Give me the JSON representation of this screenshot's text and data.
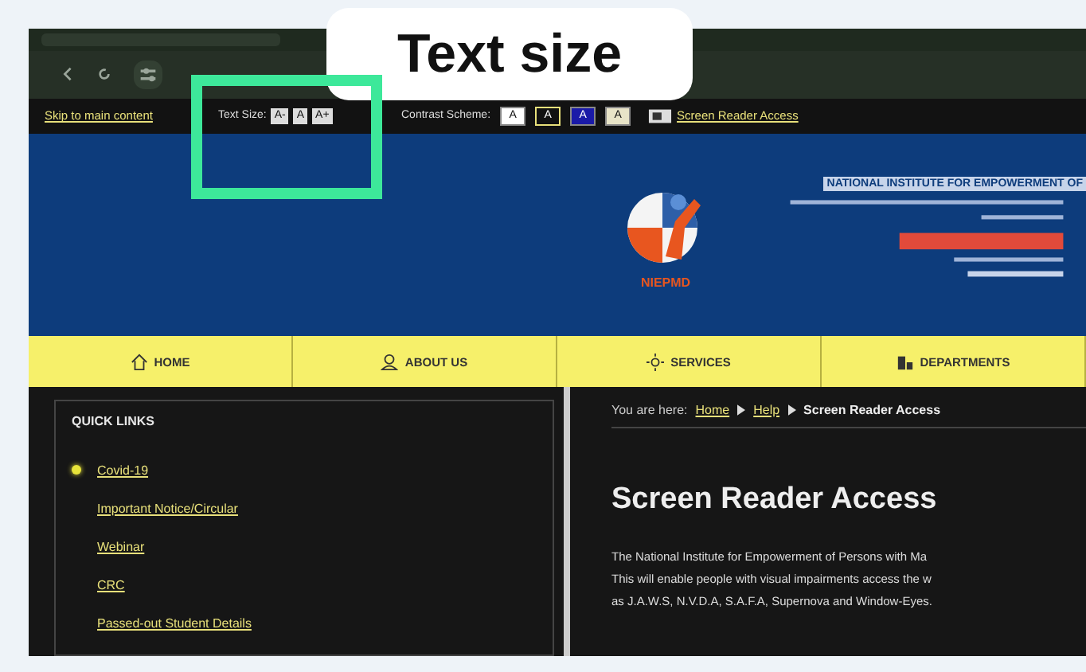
{
  "callout": {
    "label": "Text size"
  },
  "accessibility_bar": {
    "skip_link": "Skip to main content",
    "text_size_label": "Text Size:",
    "text_size_buttons": [
      "A-",
      "A",
      "A+"
    ],
    "contrast_label": "Contrast Scheme:",
    "contrast_buttons": [
      {
        "label": "A",
        "color": "#ffffff",
        "selected": false
      },
      {
        "label": "A",
        "color": "#111111",
        "selected": true
      },
      {
        "label": "A",
        "color": "#1a1aa8",
        "selected": false
      },
      {
        "label": "A",
        "color": "#e8e4c8",
        "selected": false
      }
    ],
    "screen_reader_link": "Screen Reader Access"
  },
  "header": {
    "logo_text": "NIEPMD",
    "title": "NATIONAL INSTITUTE FOR EMPOWERMENT OF"
  },
  "nav": [
    {
      "label": "HOME"
    },
    {
      "label": "ABOUT US"
    },
    {
      "label": "SERVICES"
    },
    {
      "label": "DEPARTMENTS"
    }
  ],
  "quick_links": {
    "title": "QUICK LINKS",
    "items": [
      {
        "label": "Covid-19",
        "marked": true
      },
      {
        "label": "Important Notice/Circular",
        "marked": false
      },
      {
        "label": "Webinar",
        "marked": false
      },
      {
        "label": "CRC",
        "marked": false
      },
      {
        "label": "Passed-out Student Details",
        "marked": false
      }
    ]
  },
  "breadcrumb": {
    "prefix": "You are here:",
    "links": [
      "Home",
      "Help"
    ],
    "current": "Screen Reader Access"
  },
  "content": {
    "heading": "Screen Reader Access",
    "lines": [
      "The National Institute for Empowerment of Persons with Ma",
      "This will enable people with visual impairments access the w",
      "as J.A.W.S, N.V.D.A, S.A.F.A, Supernova and Window-Eyes."
    ]
  }
}
